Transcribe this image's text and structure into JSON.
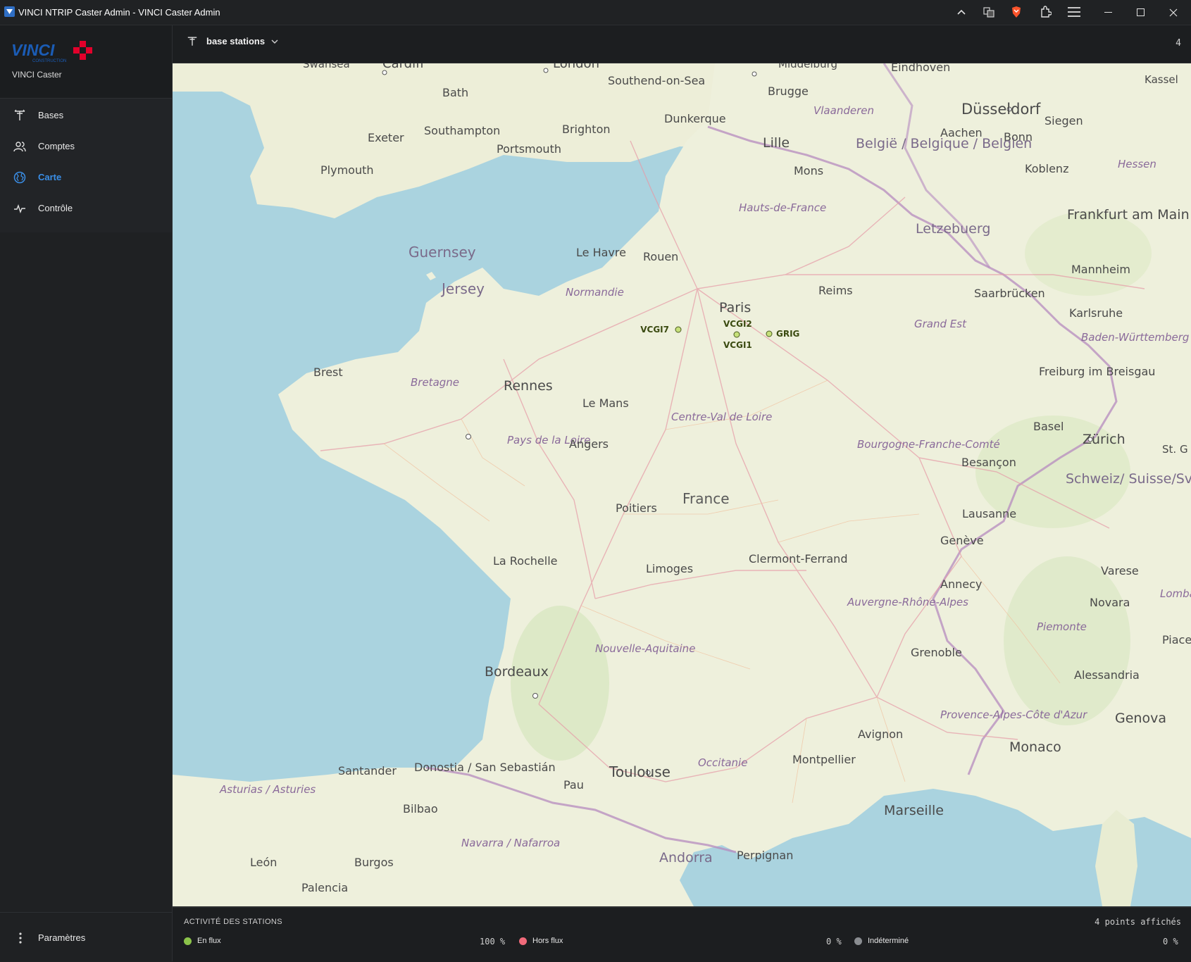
{
  "window": {
    "title": "VINCI NTRIP Caster Admin - VINCI Caster Admin"
  },
  "brand": {
    "logo_text": "VINCI",
    "logo_sub": "CONSTRUCTION",
    "app_name": "VINCI Caster"
  },
  "nav": [
    {
      "label": "Bases",
      "icon": "antenna-icon",
      "active": false
    },
    {
      "label": "Comptes",
      "icon": "users-icon",
      "active": false
    },
    {
      "label": "Carte",
      "icon": "globe-icon",
      "active": true
    },
    {
      "label": "Contrôle",
      "icon": "activity-icon",
      "active": false
    }
  ],
  "settings": {
    "label": "Paramètres"
  },
  "topbar": {
    "selector_label": "base stations",
    "count": "4"
  },
  "map": {
    "cities": [
      "Swansea",
      "Cardiff",
      "London",
      "Middelburg",
      "Eindhoven",
      "Kassel",
      "Bath",
      "Southend-on-Sea",
      "Brugge",
      "Vlaanderen",
      "Düsseldorf",
      "Siegen",
      "Exeter",
      "Southampton",
      "Brighton",
      "Dunkerque",
      "Lille",
      "Aachen",
      "Bonn",
      "Portsmouth",
      "Plymouth",
      "België / Belgique / Belgien",
      "Mons",
      "Koblenz",
      "Hessen",
      "Hauts-de-France",
      "Frankfurt am Main",
      "Letzebuerg",
      "Guernsey",
      "Le Havre",
      "Rouen",
      "Mannheim",
      "Jersey",
      "Normandie",
      "Reims",
      "Saarbrücken",
      "Paris",
      "Karlsruhe",
      "Grand Est",
      "Baden-Württemberg",
      "Brest",
      "Freiburg im Breisgau",
      "Bretagne",
      "Rennes",
      "Le Mans",
      "Centre-Val de Loire",
      "Basel",
      "Zürich",
      "St. G",
      "Pays de la Loire",
      "Angers",
      "Bourgogne-Franche-Comté",
      "Besançon",
      "Schweiz/ Suisse/Svizzera/ Svizra",
      "Poitiers",
      "France",
      "Lausanne",
      "Genève",
      "La Rochelle",
      "Limoges",
      "Clermont-Ferrand",
      "Annecy",
      "Varese",
      "Lombard",
      "Auvergne-Rhône-Alpes",
      "Novara",
      "Piemonte",
      "Piacenz",
      "Nouvelle-Aquitaine",
      "Grenoble",
      "Bordeaux",
      "Alessandria",
      "Provence-Alpes-Côte d'Azur",
      "Genova",
      "Avignon",
      "Monaco",
      "Santander",
      "Donostia / San Sebastián",
      "Toulouse",
      "Occitanie",
      "Montpellier",
      "Asturias / Asturies",
      "Pau",
      "Bilbao",
      "Marseille",
      "Navarra / Nafarroa",
      "Andorra",
      "Perpignan",
      "León",
      "Burgos",
      "Palencia"
    ],
    "stations": [
      {
        "name": "VCGI7",
        "status": "En flux"
      },
      {
        "name": "VCGI2",
        "status": "En flux"
      },
      {
        "name": "VCGI1",
        "status": "En flux"
      },
      {
        "name": "GRIG",
        "status": "En flux"
      }
    ]
  },
  "footer": {
    "header": "ACTIVITÉ DES STATIONS",
    "points_shown": "4 points affichés",
    "stats": [
      {
        "label": "En flux",
        "percent": "100 %",
        "color": "#8bc34a"
      },
      {
        "label": "Hors flux",
        "percent": "0 %",
        "color": "#f06a7a"
      },
      {
        "label": "Indéterminé",
        "percent": "0 %",
        "color": "#8a8d91"
      }
    ]
  },
  "colors": {
    "accent": "#3a8ee6",
    "sea": "#aad3df",
    "land": "#eef0dc",
    "border": "#b08fb2"
  }
}
